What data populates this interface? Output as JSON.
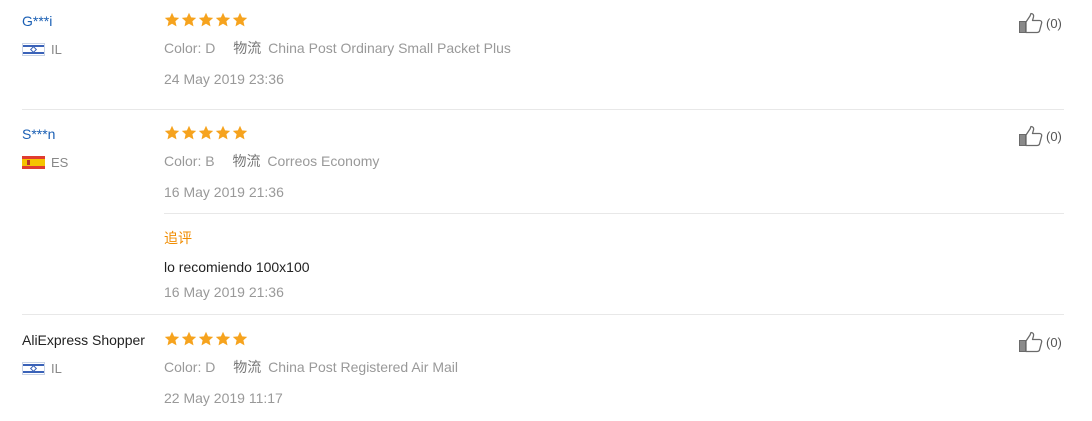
{
  "colors": {
    "star": "#f6a31e",
    "username_link": "#1a5fb4",
    "followup_label": "#f08c00",
    "meta": "#999999"
  },
  "icons": {
    "rating": "star-icon",
    "helpful": "thumbs-up-icon"
  },
  "reviews": [
    {
      "user": "G***i",
      "country": "IL",
      "flag": "israel-flag-icon",
      "rating": 5,
      "color_label": "Color: D",
      "shipping_label": "物流",
      "shipping_value": "China Post Ordinary Small Packet Plus",
      "date": "24 May 2019 23:36",
      "helpful": "(0)"
    },
    {
      "user": "S***n",
      "country": "ES",
      "flag": "spain-flag-icon",
      "rating": 5,
      "color_label": "Color: B",
      "shipping_label": "物流",
      "shipping_value": "Correos Economy",
      "date": "16 May 2019 21:36",
      "helpful": "(0)",
      "followup": {
        "label": "追评",
        "text": "lo recomiendo 100x100",
        "date": "16 May 2019 21:36"
      }
    },
    {
      "user": "AliExpress Shopper",
      "country": "IL",
      "flag": "israel-flag-icon",
      "rating": 5,
      "color_label": "Color: D",
      "shipping_label": "物流",
      "shipping_value": "China Post Registered Air Mail",
      "date": "22 May 2019 11:17",
      "helpful": "(0)"
    }
  ]
}
